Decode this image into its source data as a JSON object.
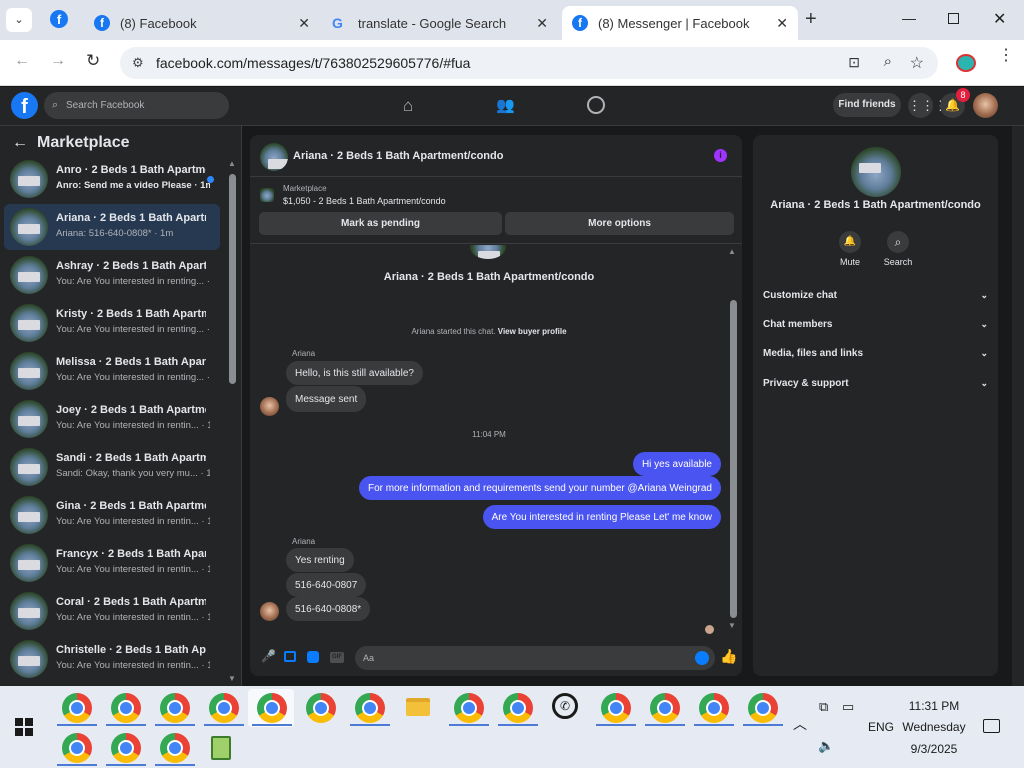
{
  "tabs": [
    {
      "title": "(8) Facebook"
    },
    {
      "title": "translate - Google Search"
    },
    {
      "title": "(8) Messenger | Facebook"
    }
  ],
  "url": "facebook.com/messages/t/763802529605776/#fua",
  "fb": {
    "search_placeholder": "Search Facebook",
    "find_friends": "Find friends",
    "notif_count": "8"
  },
  "sidebar": {
    "title": "Marketplace",
    "items": [
      {
        "title": "Anro · 2 Beds 1 Bath Apartme...",
        "snippet": "Anro: Send me a video Please · 1m"
      },
      {
        "title": "Ariana · 2 Beds 1 Bath Apartme...",
        "snippet": "Ariana: 516-640-0808* · 1m"
      },
      {
        "title": "Ashray · 2 Beds 1 Bath Apartme...",
        "snippet": "You: Are You interested in renting... · 9m"
      },
      {
        "title": "Kristy · 2 Beds 1 Bath Apartmen...",
        "snippet": "You: Are You interested in renting... · 9m"
      },
      {
        "title": "Melissa · 2 Beds 1 Bath Apartm...",
        "snippet": "You: Are You interested in renting... · 9m"
      },
      {
        "title": "Joey · 2 Beds 1 Bath Apartment...",
        "snippet": "You: Are You interested in rentin... · 10m"
      },
      {
        "title": "Sandi · 2 Beds 1 Bath Apartmen...",
        "snippet": "Sandi: Okay, thank you very mu... · 11m"
      },
      {
        "title": "Gina · 2 Beds 1 Bath Apartment...",
        "snippet": "You: Are You interested in rentin... · 12m"
      },
      {
        "title": "Francyx · 2 Beds 1 Bath Apartm...",
        "snippet": "You: Are You interested in rentin... · 12m"
      },
      {
        "title": "Coral · 2 Beds 1 Bath Apartmen...",
        "snippet": "You: Are You interested in rentin... · 12m"
      },
      {
        "title": "Christelle · 2 Beds 1 Bath Apart...",
        "snippet": "You: Are You interested in rentin... · 12m"
      }
    ]
  },
  "chat": {
    "header": "Ariana · 2 Beds 1 Bath Apartment/condo",
    "listing_label": "Marketplace",
    "listing_title": "$1,050 - 2 Beds 1 Bath Apartment/condo",
    "mark_pending": "Mark as pending",
    "more_options": "More options",
    "intro_name": "Ariana · 2 Beds 1 Bath Apartment/condo",
    "started": "Ariana started this chat.",
    "view_profile": "View buyer profile",
    "sender": "Ariana",
    "m1": "Hello, is this still available?",
    "m2": "Message sent",
    "time": "11:04 PM",
    "o1": "Hi yes available",
    "o2": "For more information and requirements send your number @Ariana Weingrad",
    "o3": "Are You  interested in renting Please Let' me know",
    "m3": "Yes renting",
    "m4": "516-640-0807",
    "m5": "516-640-0808*",
    "composer_placeholder": "Aa"
  },
  "info": {
    "title": "Ariana · 2 Beds 1 Bath Apartment/condo",
    "mute": "Mute",
    "search": "Search",
    "sections": [
      "Customize chat",
      "Chat members",
      "Media, files and links",
      "Privacy & support"
    ]
  },
  "tray": {
    "lang": "ENG",
    "time": "11:31 PM",
    "day": "Wednesday",
    "date": "9/3/2025"
  }
}
